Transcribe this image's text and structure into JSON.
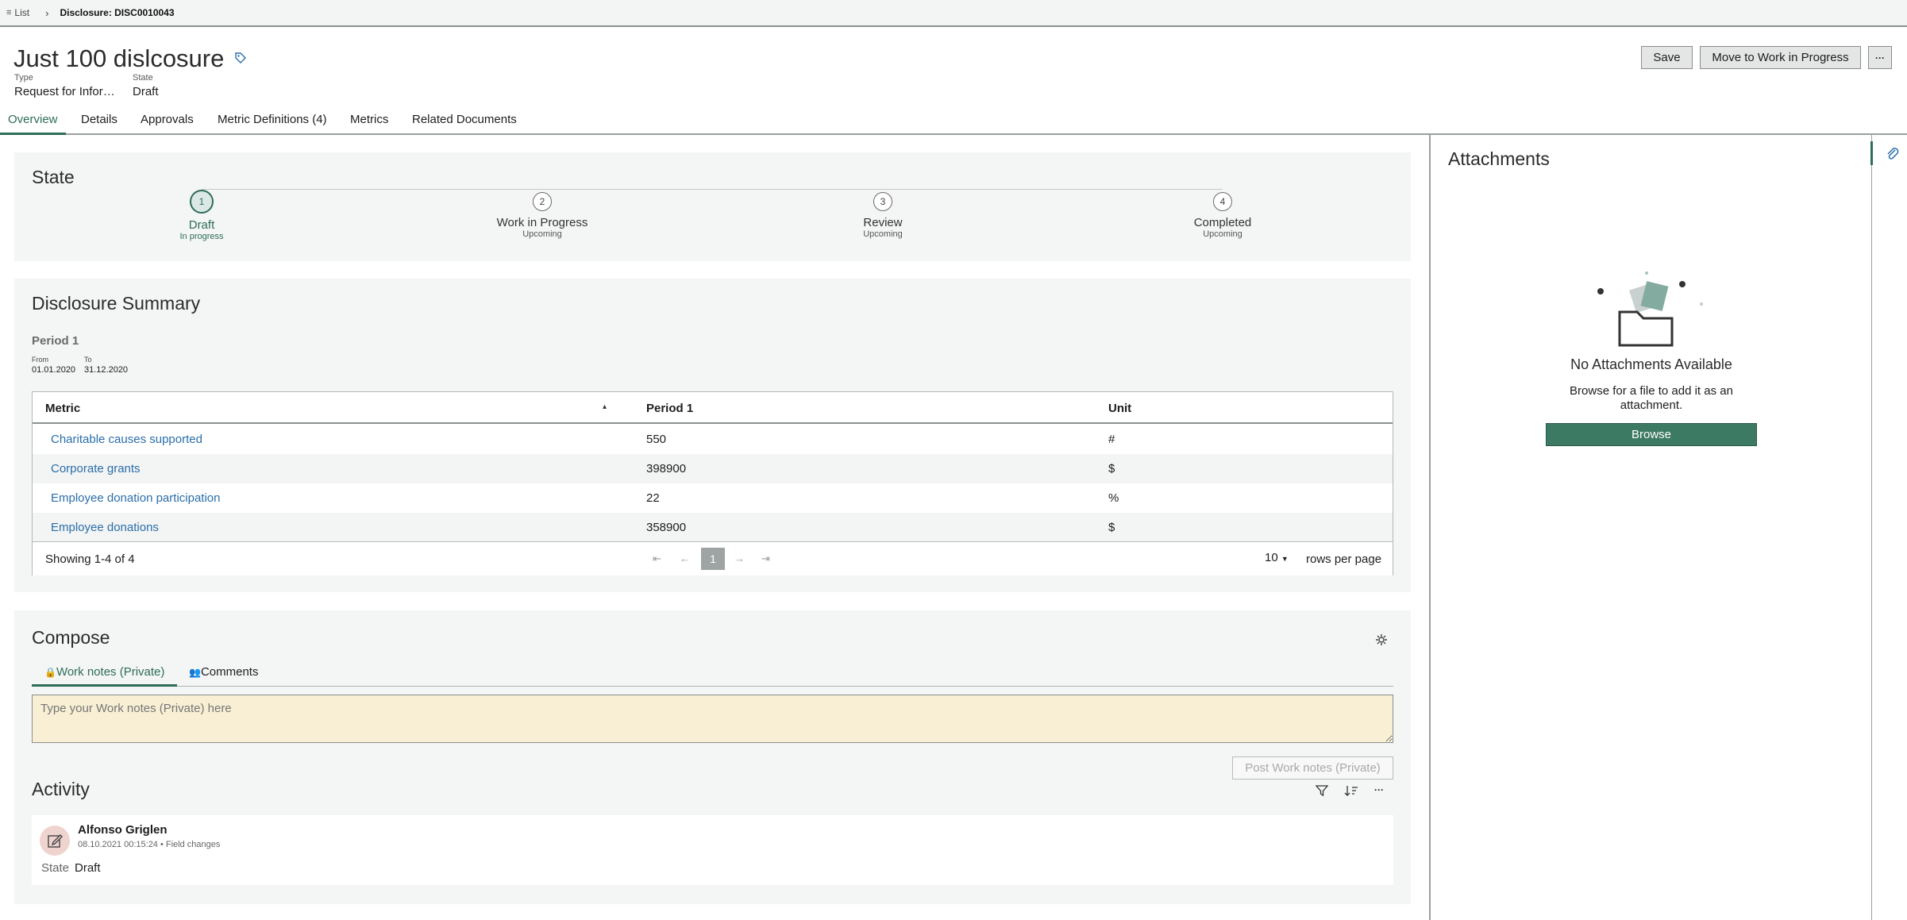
{
  "breadcrumb": {
    "list_label": "List",
    "separator": "›",
    "current": "Disclosure: DISC0010043"
  },
  "header": {
    "title": "Just 100 dislcosure",
    "type_label": "Type",
    "type_value": "Request for Infor…",
    "state_label": "State",
    "state_value": "Draft",
    "save_label": "Save",
    "move_label": "Move to Work in Progress",
    "more_label": "···"
  },
  "tabs": [
    {
      "label": "Overview"
    },
    {
      "label": "Details"
    },
    {
      "label": "Approvals"
    },
    {
      "label": "Metric Definitions (4)"
    },
    {
      "label": "Metrics"
    },
    {
      "label": "Related Documents"
    }
  ],
  "state_panel": {
    "title": "State",
    "steps": [
      {
        "num": "1",
        "name": "Draft",
        "status": "In progress"
      },
      {
        "num": "2",
        "name": "Work in Progress",
        "status": "Upcoming"
      },
      {
        "num": "3",
        "name": "Review",
        "status": "Upcoming"
      },
      {
        "num": "4",
        "name": "Completed",
        "status": "Upcoming"
      }
    ]
  },
  "summary": {
    "title": "Disclosure Summary",
    "period_title": "Period 1",
    "from_label": "From",
    "from_value": "01.01.2020",
    "to_label": "To",
    "to_value": "31.12.2020",
    "columns": [
      "Metric",
      "Period 1",
      "Unit"
    ],
    "sort_indicator": "▴",
    "rows": [
      {
        "metric": "Charitable causes supported",
        "period1": "550",
        "unit": "#"
      },
      {
        "metric": "Corporate grants",
        "period1": "398900",
        "unit": "$"
      },
      {
        "metric": "Employee donation participation",
        "period1": "22",
        "unit": "%"
      },
      {
        "metric": "Employee donations",
        "period1": "358900",
        "unit": "$"
      }
    ],
    "showing": "Showing 1-4 of 4",
    "page": "1",
    "rows_per_page_value": "10",
    "rows_per_page_label": "rows per page",
    "pager": {
      "first": "⇤",
      "prev": "←",
      "next": "→",
      "last": "⇥"
    }
  },
  "compose": {
    "title": "Compose",
    "tab_worknotes": "Work notes (Private)",
    "tab_comments": "Comments",
    "placeholder": "Type your Work notes (Private) here",
    "post_label": "Post Work notes (Private)"
  },
  "activity": {
    "title": "Activity",
    "more_label": "···",
    "entry": {
      "author": "Alfonso Griglen",
      "meta": "08.10.2021 00:15:24 • Field changes",
      "field_label": "State",
      "field_value": "Draft"
    }
  },
  "attachments": {
    "title": "Attachments",
    "empty_title": "No Attachments Available",
    "empty_text_line1": "Browse for a file to add it as an",
    "empty_text_line2": "attachment.",
    "browse_label": "Browse"
  },
  "colors": {
    "accent": "#2e6d5a",
    "link": "#2a6ea8",
    "panel": "#f4f5f5",
    "notes_bg": "#f8efd4"
  }
}
